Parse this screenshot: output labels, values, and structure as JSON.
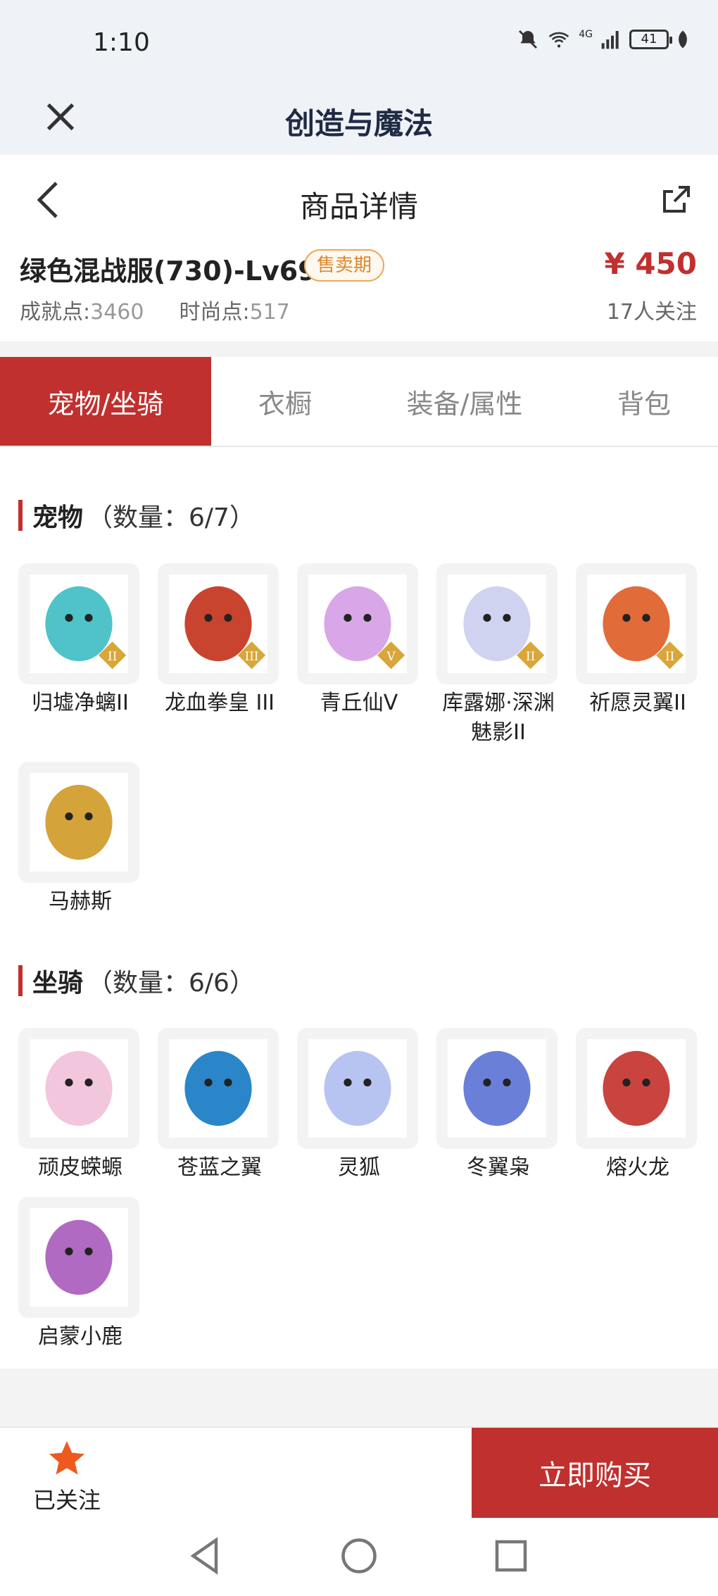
{
  "status": {
    "time": "1:10",
    "network": "4G",
    "battery": "41"
  },
  "app": {
    "title": "创造与魔法"
  },
  "nav": {
    "title": "商品详情"
  },
  "product": {
    "name": "绿色混战服(730)-Lv69",
    "badge": "售卖期",
    "achievement_label": "成就点:",
    "achievement_value": "3460",
    "fashion_label": "时尚点:",
    "fashion_value": "517",
    "price": "¥ 450",
    "followers": "17人关注"
  },
  "tabs": [
    {
      "label": "宠物/坐骑",
      "active": true
    },
    {
      "label": "衣橱",
      "active": false
    },
    {
      "label": "装备/属性",
      "active": false
    },
    {
      "label": "背包",
      "active": false
    }
  ],
  "pets": {
    "title": "宠物",
    "count": "（数量：6/7）",
    "items": [
      {
        "name": "归墟净螭II",
        "tier": "II",
        "color": "#4fc3c8"
      },
      {
        "name": "龙血拳皇 III",
        "tier": "III",
        "color": "#c8442e"
      },
      {
        "name": "青丘仙V",
        "tier": "V",
        "color": "#d9a7e8"
      },
      {
        "name": "库露娜·深渊魅影II",
        "tier": "II",
        "color": "#cfd3f0"
      },
      {
        "name": "祈愿灵翼II",
        "tier": "II",
        "color": "#e26b3a"
      },
      {
        "name": "马赫斯",
        "tier": "",
        "color": "#d4a33a"
      }
    ]
  },
  "mounts": {
    "title": "坐骑",
    "count": "（数量：6/6）",
    "items": [
      {
        "name": "顽皮蝾螈",
        "color": "#f2c6dc"
      },
      {
        "name": "苍蓝之翼",
        "color": "#2a86c8"
      },
      {
        "name": "灵狐",
        "color": "#b7c4f2"
      },
      {
        "name": "冬翼枭",
        "color": "#6a7fd8"
      },
      {
        "name": "熔火龙",
        "color": "#c9443e"
      },
      {
        "name": "启蒙小鹿",
        "color": "#b06ac2"
      }
    ]
  },
  "bottom": {
    "follow_label": "已关注",
    "buy_label": "立即购买"
  }
}
